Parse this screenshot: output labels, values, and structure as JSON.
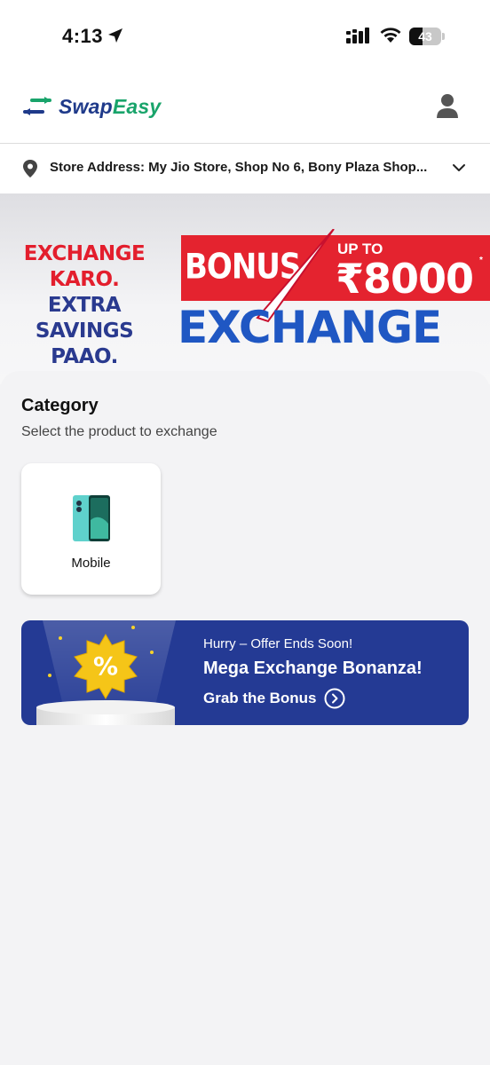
{
  "status_bar": {
    "time": "4:13",
    "battery_level": "43",
    "battery_fraction": 0.43
  },
  "header": {
    "brand_part1": "Swap",
    "brand_part2": "Easy",
    "brand_colors": {
      "primary": "#1f3a8a",
      "accent": "#19a46b"
    },
    "profile_icon": "user-icon"
  },
  "address": {
    "text": "Store Address: My Jio Store, Shop No 6, Bony Plaza Shop...",
    "icon": "location-pin-icon",
    "chevron": "chevron-down-icon"
  },
  "banner": {
    "line1": "EXCHANGE",
    "line2": "KARO.",
    "line3": "EXTRA SAVINGS",
    "line4": "PAAO.",
    "bonus": "BONUS",
    "upto": "UP TO",
    "amount": "₹8000",
    "asterisk": "*",
    "exchange": "EXCHANGE",
    "colors": {
      "red": "#e4232f",
      "blue": "#1f57c3",
      "navy": "#2a3a8f"
    }
  },
  "category": {
    "title": "Category",
    "subtitle": "Select the product to exchange",
    "items": [
      {
        "label": "Mobile",
        "icon": "mobile-phone-image"
      }
    ]
  },
  "promo": {
    "kicker": "Hurry – Offer Ends Soon!",
    "title": "Mega Exchange Bonanza!",
    "cta": "Grab the Bonus",
    "badge_symbol": "%",
    "cta_icon": "chevron-right-circle-icon",
    "background": "#243a94"
  }
}
